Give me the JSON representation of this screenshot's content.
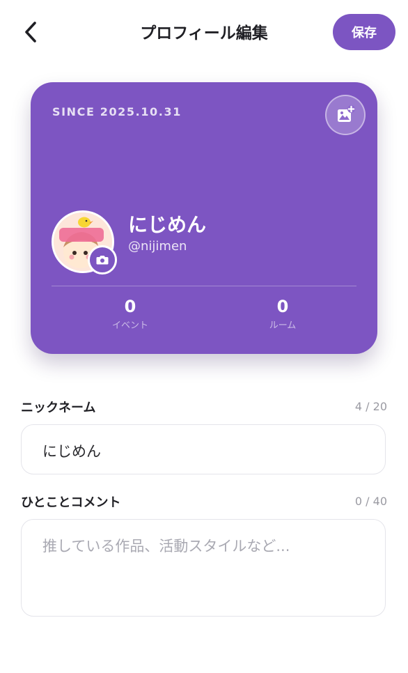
{
  "header": {
    "title": "プロフィール編集",
    "save_label": "保存",
    "back_icon": "chevron-left-icon"
  },
  "card": {
    "since": "SINCE 2025.10.31",
    "display_name": "にじめん",
    "handle": "@nijimen",
    "avatar_text": "にじめん",
    "stats": [
      {
        "value": "0",
        "label": "イベント"
      },
      {
        "value": "0",
        "label": "ルーム"
      }
    ],
    "accent_color": "#7d55c2"
  },
  "form": {
    "nickname": {
      "label": "ニックネーム",
      "counter": "4 / 20",
      "value": "にじめん"
    },
    "comment": {
      "label": "ひとことコメント",
      "counter": "0 / 40",
      "placeholder": "推している作品、活動スタイルなど..."
    }
  }
}
